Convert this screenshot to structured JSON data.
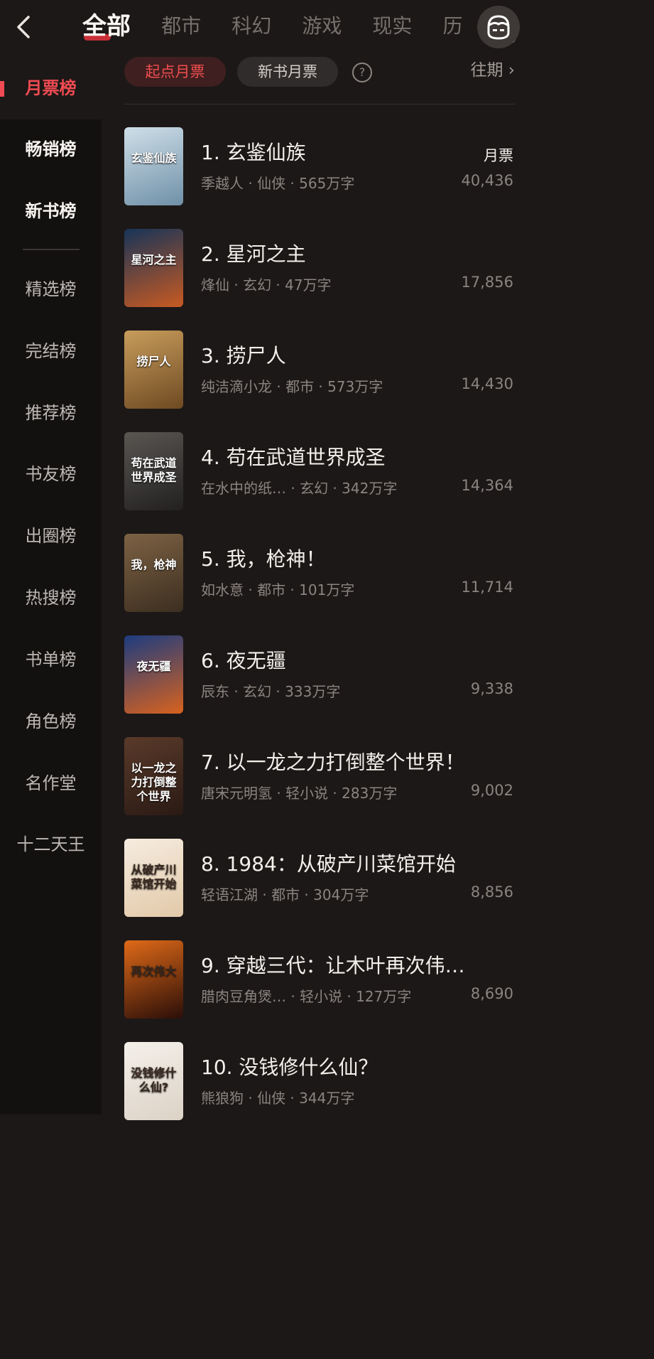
{
  "header": {
    "tabs": [
      "全部",
      "都市",
      "科幻",
      "游戏",
      "现实",
      "历"
    ]
  },
  "sidebar": {
    "items": [
      "月票榜",
      "畅销榜",
      "新书榜",
      "精选榜",
      "完结榜",
      "推荐榜",
      "书友榜",
      "出圈榜",
      "热搜榜",
      "书单榜",
      "角色榜",
      "名作堂",
      "十二天王"
    ]
  },
  "filter": {
    "pill_active": "起点月票",
    "pill_other": "新书月票",
    "help": "?",
    "past": "往期"
  },
  "list": {
    "votes_label": "月票",
    "books": [
      {
        "title": "1. 玄鉴仙族",
        "meta": "季越人 · 仙侠 · 565万字",
        "votes": "40,436",
        "cover_text": "玄鉴仙族",
        "c1": "#cfdfe8",
        "c2": "#6f90a8"
      },
      {
        "title": "2. 星河之主",
        "meta": "烽仙 · 玄幻 · 47万字",
        "votes": "17,856",
        "cover_text": "星河之主",
        "c1": "#173458",
        "c2": "#c85a22"
      },
      {
        "title": "3. 捞尸人",
        "meta": "纯洁滴小龙 · 都市 · 573万字",
        "votes": "14,430",
        "cover_text": "捞尸人",
        "c1": "#c89c5c",
        "c2": "#6e4a22"
      },
      {
        "title": "4. 苟在武道世界成圣",
        "meta": "在水中的纸… · 玄幻 · 342万字",
        "votes": "14,364",
        "cover_text": "苟在武道世界成圣",
        "c1": "#595652",
        "c2": "#222020"
      },
      {
        "title": "5. 我，枪神！",
        "meta": "如水意 · 都市 · 101万字",
        "votes": "11,714",
        "cover_text": "我，枪神",
        "c1": "#7d6244",
        "c2": "#3c2e20"
      },
      {
        "title": "6. 夜无疆",
        "meta": "辰东 · 玄幻 · 333万字",
        "votes": "9,338",
        "cover_text": "夜无疆",
        "c1": "#1c3c80",
        "c2": "#d8621e"
      },
      {
        "title": "7. 以一龙之力打倒整个世界！",
        "meta": "唐宋元明氢 · 轻小说 · 283万字",
        "votes": "9,002",
        "cover_text": "以一龙之力打倒整个世界",
        "c1": "#5a3a2a",
        "c2": "#2a1a14"
      },
      {
        "title": "8. 1984：从破产川菜馆开始",
        "meta": "轻语江湖 · 都市 · 304万字",
        "votes": "8,856",
        "cover_text": "从破产川菜馆开始",
        "c1": "#f6ece0",
        "c2": "#e2c9a8"
      },
      {
        "title": "9. 穿越三代：让木叶再次伟…",
        "meta": "腊肉豆角煲… · 轻小说 · 127万字",
        "votes": "8,690",
        "cover_text": "再次伟大",
        "c1": "#e06a18",
        "c2": "#2a0e08"
      },
      {
        "title": "10. 没钱修什么仙？",
        "meta": "熊狼狗 · 仙侠 · 344万字",
        "votes": "",
        "cover_text": "没钱修什么仙?",
        "c1": "#f4f0ea",
        "c2": "#dcd2c6"
      }
    ]
  }
}
